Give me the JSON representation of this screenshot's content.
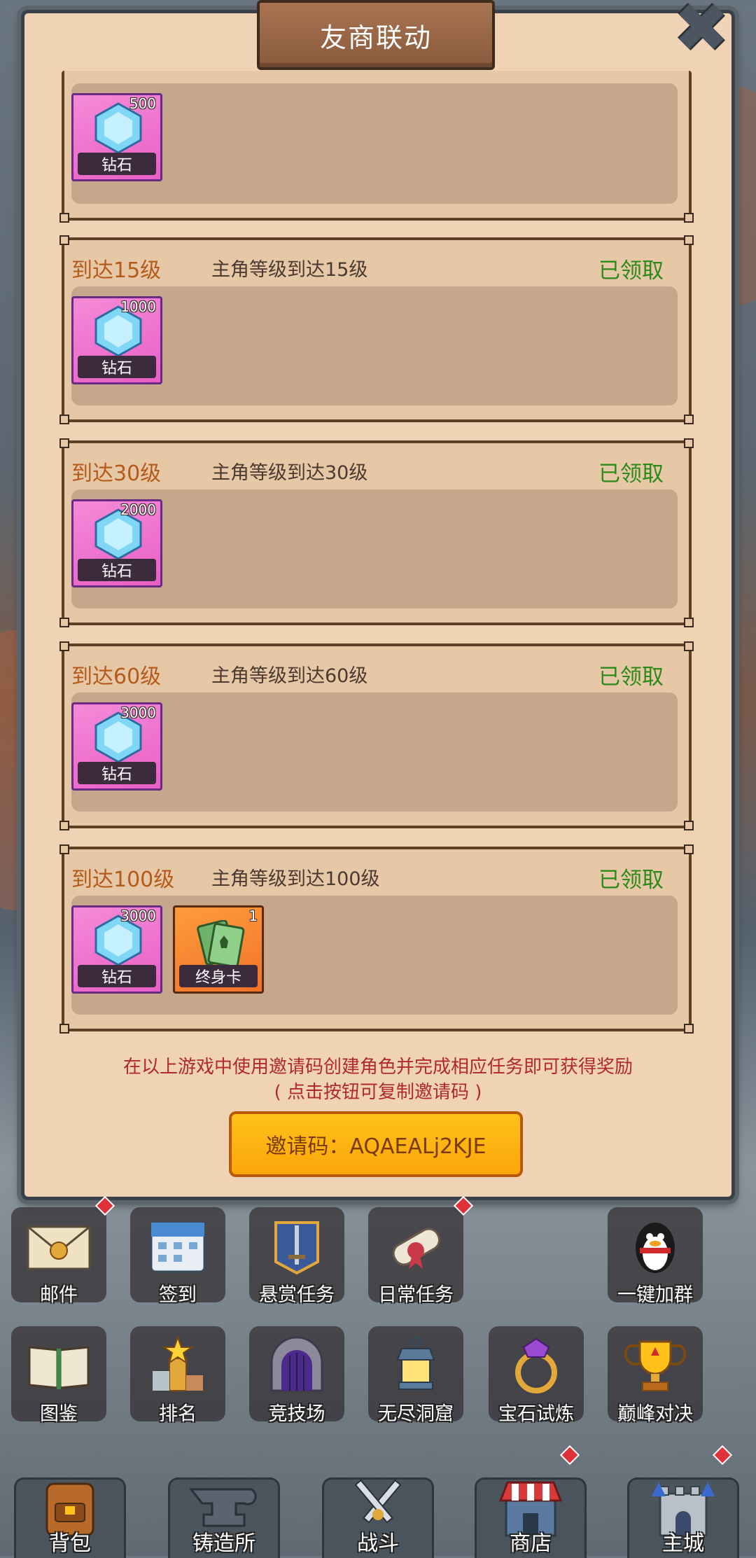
{
  "dialog": {
    "title": "友商联动",
    "close_glyph": "✖"
  },
  "rewards": {
    "partial": {
      "amount": "500",
      "name": "钻石"
    },
    "tasks": [
      {
        "level": "到达15级",
        "desc": "主角等级到达15级",
        "status": "已领取",
        "items": [
          {
            "type": "diamond",
            "amount": "1000",
            "name": "钻石"
          }
        ]
      },
      {
        "level": "到达30级",
        "desc": "主角等级到达30级",
        "status": "已领取",
        "items": [
          {
            "type": "diamond",
            "amount": "2000",
            "name": "钻石"
          }
        ]
      },
      {
        "level": "到达60级",
        "desc": "主角等级到达60级",
        "status": "已领取",
        "items": [
          {
            "type": "diamond",
            "amount": "3000",
            "name": "钻石"
          }
        ]
      },
      {
        "level": "到达100级",
        "desc": "主角等级到达100级",
        "status": "已领取",
        "items": [
          {
            "type": "diamond",
            "amount": "3000",
            "name": "钻石"
          },
          {
            "type": "card",
            "amount": "1",
            "name": "终身卡"
          }
        ]
      }
    ]
  },
  "footer": {
    "line1": "在以上游戏中使用邀请码创建角色并完成相应任务即可获得奖励",
    "line2": "( 点击按钮可复制邀请码 )",
    "invite_button": "邀请码：AQAEALj2KJE"
  },
  "menu_row1": [
    {
      "label": "邮件",
      "icon": "mail-icon",
      "badge": true
    },
    {
      "label": "签到",
      "icon": "calendar-icon",
      "badge": false
    },
    {
      "label": "悬赏任务",
      "icon": "sword-banner-icon",
      "badge": false
    },
    {
      "label": "日常任务",
      "icon": "scroll-icon",
      "badge": true
    },
    {
      "label": "一键加群",
      "icon": "qq-penguin-icon",
      "badge": false
    }
  ],
  "menu_row2": [
    {
      "label": "图鉴",
      "icon": "book-icon"
    },
    {
      "label": "排名",
      "icon": "podium-icon"
    },
    {
      "label": "竞技场",
      "icon": "arena-gate-icon"
    },
    {
      "label": "无尽洞窟",
      "icon": "lantern-icon"
    },
    {
      "label": "宝石试炼",
      "icon": "gem-ring-icon"
    },
    {
      "label": "巅峰对决",
      "icon": "trophy-icon"
    }
  ],
  "bottom_nav": [
    {
      "label": "背包",
      "icon": "backpack-icon",
      "badge": false
    },
    {
      "label": "铸造所",
      "icon": "anvil-icon",
      "badge": false
    },
    {
      "label": "战斗",
      "icon": "crossed-swords-icon",
      "badge": false
    },
    {
      "label": "商店",
      "icon": "shop-icon",
      "badge": true
    },
    {
      "label": "主城",
      "icon": "castle-icon",
      "badge": true
    }
  ],
  "colors": {
    "panel_bg": "#efd3b4",
    "level_text": "#b45a1c",
    "claimed_text": "#2c8a1a",
    "notice_text": "#b12a2a",
    "invite_button": "#fba60a"
  }
}
